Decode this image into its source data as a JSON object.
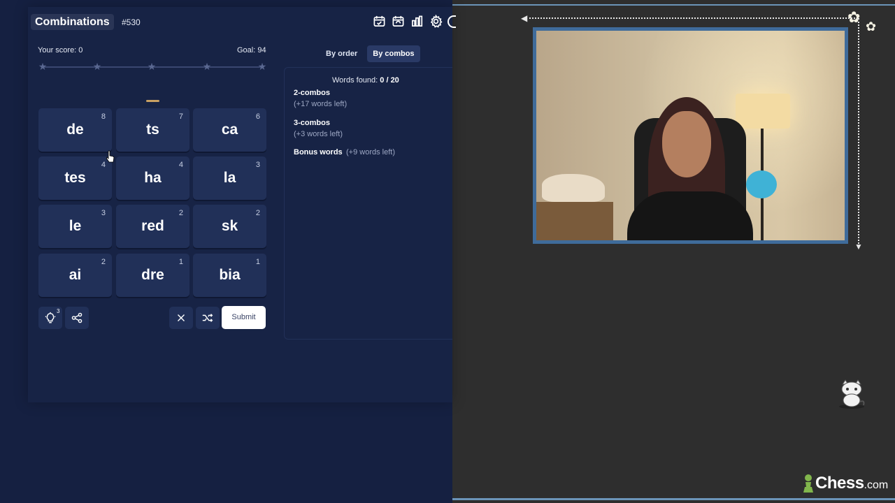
{
  "game": {
    "title": "Combinations",
    "puzzle_number": "#530",
    "score_label": "Your score: 0",
    "goal_label": "Goal: 94",
    "progress_stars": 5,
    "tiles": [
      {
        "text": "de",
        "count": "8"
      },
      {
        "text": "ts",
        "count": "7"
      },
      {
        "text": "ca",
        "count": "6"
      },
      {
        "text": "tes",
        "count": "4"
      },
      {
        "text": "ha",
        "count": "4"
      },
      {
        "text": "la",
        "count": "3"
      },
      {
        "text": "le",
        "count": "3"
      },
      {
        "text": "red",
        "count": "2"
      },
      {
        "text": "sk",
        "count": "2"
      },
      {
        "text": "ai",
        "count": "2"
      },
      {
        "text": "dre",
        "count": "1"
      },
      {
        "text": "bia",
        "count": "1"
      }
    ],
    "hint_count": "3",
    "submit_label": "Submit",
    "toolbar_icons": [
      "calendar-check-icon",
      "calendar-refresh-icon",
      "stats-icon",
      "settings-icon"
    ]
  },
  "words": {
    "tabs": {
      "by_order": "By order",
      "by_combos": "By combos"
    },
    "found_prefix": "Words found: ",
    "found_value": "0 / 20",
    "groups": [
      {
        "title": "2-combos",
        "sub": "(+17 words left)"
      },
      {
        "title": "3-combos",
        "sub": "(+3 words left)"
      },
      {
        "title": "Bonus words",
        "sub": "(+9 words left)"
      }
    ]
  },
  "branding": {
    "logo_word": "Chess",
    "logo_domain": ".com"
  },
  "colors": {
    "accent": "#6b94b8",
    "game_bg": "#152041",
    "tile": "#213058"
  }
}
